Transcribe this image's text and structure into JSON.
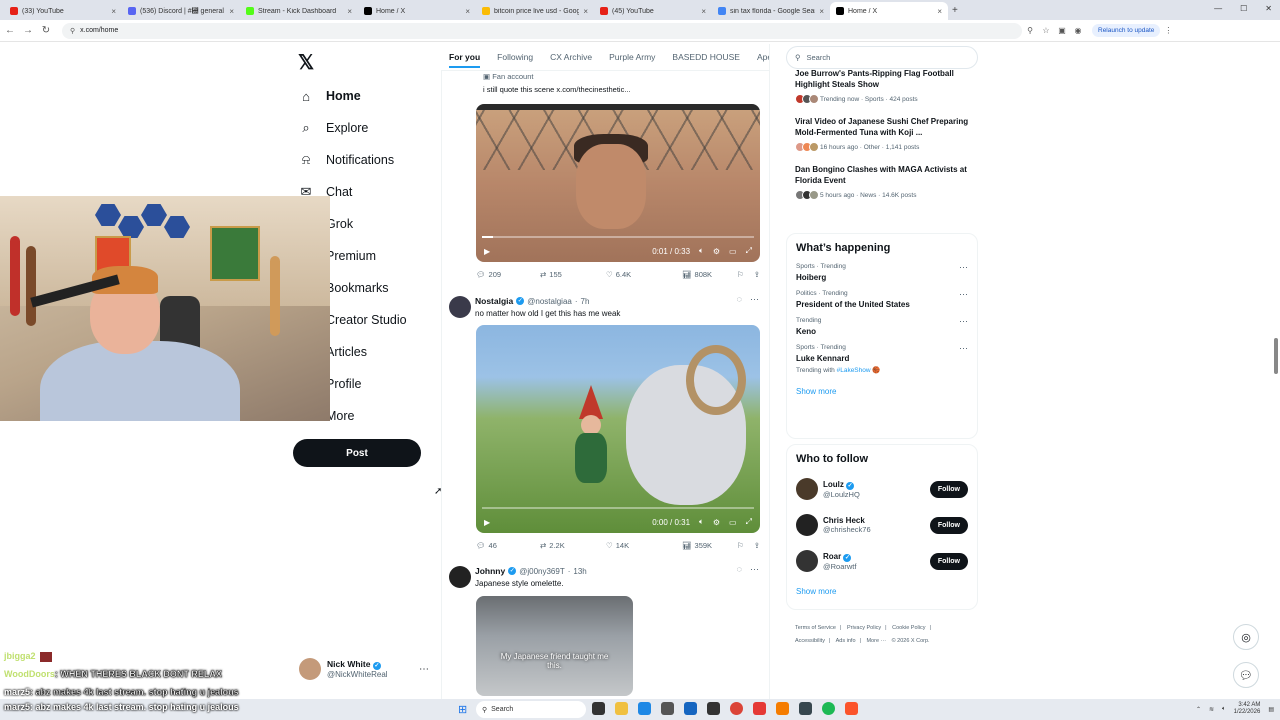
{
  "browser": {
    "tabs": [
      {
        "label": "(33) YouTube",
        "color": "#e62117",
        "active": false
      },
      {
        "label": "(536) Discord | #⴪ general",
        "color": "#5865f2",
        "active": false
      },
      {
        "label": "Stream - Kick Dashboard",
        "color": "#53fc18",
        "active": false
      },
      {
        "label": "Home / X",
        "color": "#000000",
        "active": false
      },
      {
        "label": "bitcoin price live usd - Google S",
        "color": "#fbbc05",
        "active": false
      },
      {
        "label": "(45) YouTube",
        "color": "#e62117",
        "active": false
      },
      {
        "label": "sin tax florida - Google Search",
        "color": "#4285f4",
        "active": false
      },
      {
        "label": "Home / X",
        "color": "#000000",
        "active": true
      }
    ],
    "url": "x.com/home",
    "relaunch": "Relaunch to update"
  },
  "nav": {
    "items": [
      {
        "label": "Home",
        "icon": "⌂"
      },
      {
        "label": "Explore",
        "icon": "⌕"
      },
      {
        "label": "Notifications",
        "icon": "⍾"
      },
      {
        "label": "Chat",
        "icon": "✉"
      },
      {
        "label": "Grok",
        "icon": "▣"
      },
      {
        "label": "Premium",
        "icon": "X"
      },
      {
        "label": "Bookmarks",
        "icon": "⚐"
      },
      {
        "label": "Creator Studio",
        "icon": "≡"
      },
      {
        "label": "Articles",
        "icon": "▤"
      },
      {
        "label": "Profile",
        "icon": "☺"
      },
      {
        "label": "More",
        "icon": "⋯"
      }
    ],
    "post_label": "Post",
    "account": {
      "name": "Nick White",
      "handle": "@NickWhiteReal"
    }
  },
  "feed": {
    "tabs": [
      "For you",
      "Following",
      "CX Archive",
      "Purple Army",
      "BASEDD HOUSE",
      "Ape"
    ],
    "post0": {
      "fan_account": "Fan account",
      "quote": "i still quote this scene  x.com/thecinesthetic...",
      "video_time": "0:01 / 0:33",
      "progress": 0.04,
      "replies": "209",
      "reposts": "155",
      "likes": "6.4K",
      "views": "808K"
    },
    "post1": {
      "name": "Nostalgia",
      "handle": "@nostalgiaa",
      "time": "7h",
      "text": "no matter how old I get this has me weak",
      "video_time": "0:00 / 0:31",
      "progress": 0.0,
      "replies": "46",
      "reposts": "2.2K",
      "likes": "14K",
      "views": "359K"
    },
    "post2": {
      "name": "Johnny",
      "handle": "@j00ny369T",
      "time": "13h",
      "text": "Japanese style omelette.",
      "subtitle": "My Japanese friend taught me this."
    }
  },
  "right": {
    "search_placeholder": "Search",
    "top_trends": [
      {
        "title": "Joe Burrow's Pants-Ripping Flag Football Highlight Steals Show",
        "meta": "Trending now · Sports · 424 posts"
      },
      {
        "title": "Viral Video of Japanese Sushi Chef Preparing Mold-Fermented Tuna with Koji ...",
        "meta": "16 hours ago · Other · 1,141 posts"
      },
      {
        "title": "Dan Bongino Clashes with MAGA Activists at Florida Event",
        "meta": "5 hours ago · News · 14.6K posts"
      }
    ],
    "happening": {
      "title": "What’s happening",
      "items": [
        {
          "category": "Sports · Trending",
          "name": "Hoiberg",
          "extra": ""
        },
        {
          "category": "Politics · Trending",
          "name": "President of the United States",
          "extra": ""
        },
        {
          "category": "Trending",
          "name": "Keno",
          "extra": ""
        },
        {
          "category": "Sports · Trending",
          "name": "Luke Kennard",
          "extra_prefix": "Trending with ",
          "extra": "#LakeShow 🏀"
        }
      ],
      "show_more": "Show more"
    },
    "who_to_follow": {
      "title": "Who to follow",
      "items": [
        {
          "name": "Loulz",
          "handle": "@LoulzHQ"
        },
        {
          "name": "Chris Heck",
          "handle": "@chrisheck76"
        },
        {
          "name": "Roar",
          "handle": "@Roarwtf"
        }
      ],
      "follow_label": "Follow",
      "show_more": "Show more"
    },
    "footer": {
      "row1": [
        "Terms of Service",
        "|",
        "Privacy Policy",
        "|",
        "Cookie Policy",
        "|"
      ],
      "row2": [
        "Accessibility",
        "|",
        "Ads info",
        "|",
        "More ···",
        "© 2026 X Corp."
      ]
    }
  },
  "chat": [
    {
      "user": "jbigga2",
      "msg": ""
    },
    {
      "user": "WoodDoors",
      "msg": ": WHEN THERES BLACK DONT RELAX"
    },
    {
      "user": "marz5",
      "msg": ": abz makes 4k last stream. stop hating u jealous"
    },
    {
      "user": "marz5",
      "msg": ": abz makes 4k last stream. stop hating u jealous"
    }
  ],
  "taskbar": {
    "search": "Search",
    "time": "3:42 AM",
    "date": "1/22/2026"
  }
}
